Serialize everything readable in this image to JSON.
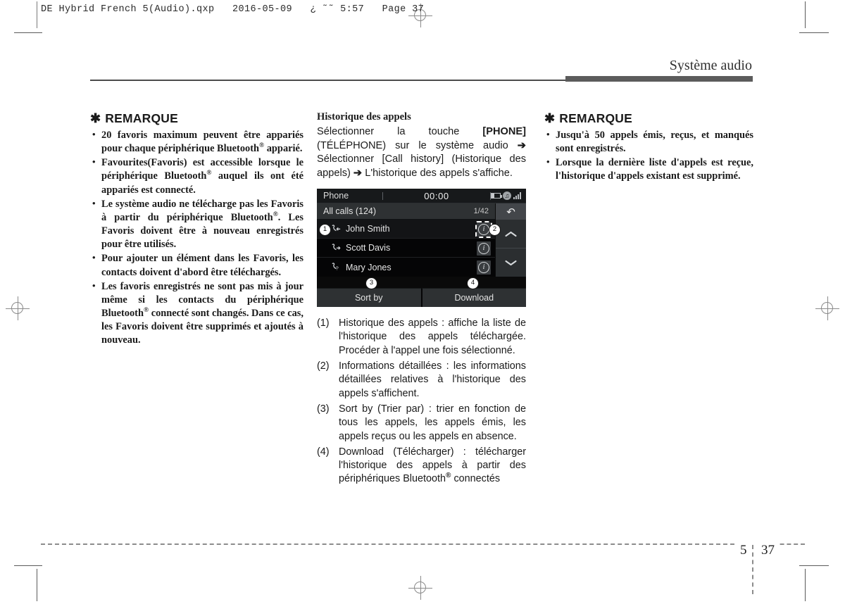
{
  "prepress": {
    "film_header": "DE Hybrid French 5(Audio).qxp   2016-05-09   ¿ ˜˜ 5:57   Page 37"
  },
  "running_head": {
    "title": "Système audio"
  },
  "left_column": {
    "note_star": "✱",
    "note_title": "REMARQUE",
    "bullets": [
      "20 favoris maximum peuvent être appariés pour chaque périphérique Bluetooth® apparié.",
      "Favourites(Favoris) est accessible lorsque le périphérique Bluetooth® auquel ils ont été appariés est connecté.",
      "Le système audio ne télécharge pas les Favoris à partir du périphérique Bluetooth®. Les Favoris doivent être à nouveau enregistrés pour être utilisés.",
      "Pour ajouter un élément dans les Favoris, les contacts doivent d'abord être téléchargés.",
      "Les favoris enregistrés ne sont pas mis à jour même si les contacts du périphérique Bluetooth® connecté sont changés. Dans ce cas, les Favoris doivent être supprimés et ajoutés à nouveau."
    ]
  },
  "mid_column": {
    "heading": "Historique des appels",
    "intro_parts": {
      "p1": "Sélectionner la touche ",
      "b1": "[PHONE]",
      "p2": " (TÉLÉPHONE) sur le système audio ",
      "a1": "➔",
      "p3": " Sélectionner [Call history] (Historique des appels) ",
      "a2": "➔",
      "p4": " L'historique des appels s'affiche."
    },
    "numbered": [
      {
        "marker": "(1)",
        "text": "Historique des appels : affiche la liste de l'historique des appels téléchargée. Procéder à l'appel une fois sélectionné."
      },
      {
        "marker": "(2)",
        "text": "Informations détaillées : les informations détaillées relatives à l'historique des appels s'affichent."
      },
      {
        "marker": "(3)",
        "text": "Sort by (Trier par) : trier en fonction de tous les appels, les appels émis, les appels reçus ou les appels en absence."
      },
      {
        "marker": "(4)",
        "text": "Download (Télécharger) : télécharger l'historique des appels à partir des périphériques Bluetooth® connectés"
      }
    ]
  },
  "right_column": {
    "note_star": "✱",
    "note_title": "REMARQUE",
    "bullets": [
      "Jusqu'à 50 appels émis, reçus, et manqués sont enregistrés.",
      "Lorsque la dernière liste d'appels est reçue, l'historique d'appels existant est supprimé."
    ]
  },
  "device_screen": {
    "status_bar": {
      "label": "Phone",
      "clock": "00:00",
      "icons": [
        "battery-icon",
        "bluetooth-icon",
        "signal-icon"
      ]
    },
    "title_bar": {
      "title": "All calls (124)",
      "page_indicator": "1/42",
      "back_glyph": "↶"
    },
    "rows": [
      {
        "name": "John Smith",
        "call_type": "incoming",
        "type_glyph": "←",
        "info_glyph": "i",
        "selected": true,
        "info_highlight": true
      },
      {
        "name": "Scott Davis",
        "call_type": "outgoing",
        "type_glyph": "→",
        "info_glyph": "i",
        "selected": false,
        "info_highlight": false
      },
      {
        "name": "Mary Jones",
        "call_type": "missed",
        "type_glyph": "?",
        "info_glyph": "i",
        "selected": false,
        "info_highlight": false
      }
    ],
    "scroll": {
      "up_glyph": "⌃",
      "down_glyph": "⌄"
    },
    "footer_buttons": [
      {
        "label": "Sort by"
      },
      {
        "label": "Download"
      }
    ],
    "callouts": [
      {
        "id": "1"
      },
      {
        "id": "2"
      },
      {
        "id": "3"
      },
      {
        "id": "4"
      }
    ],
    "colors": {
      "screen_bg": "#050506",
      "bar_bg": "#2e3133",
      "status_bg": "#17191b",
      "text": "#e6e6e6"
    }
  },
  "footer": {
    "chapter": "5",
    "page": "37"
  }
}
